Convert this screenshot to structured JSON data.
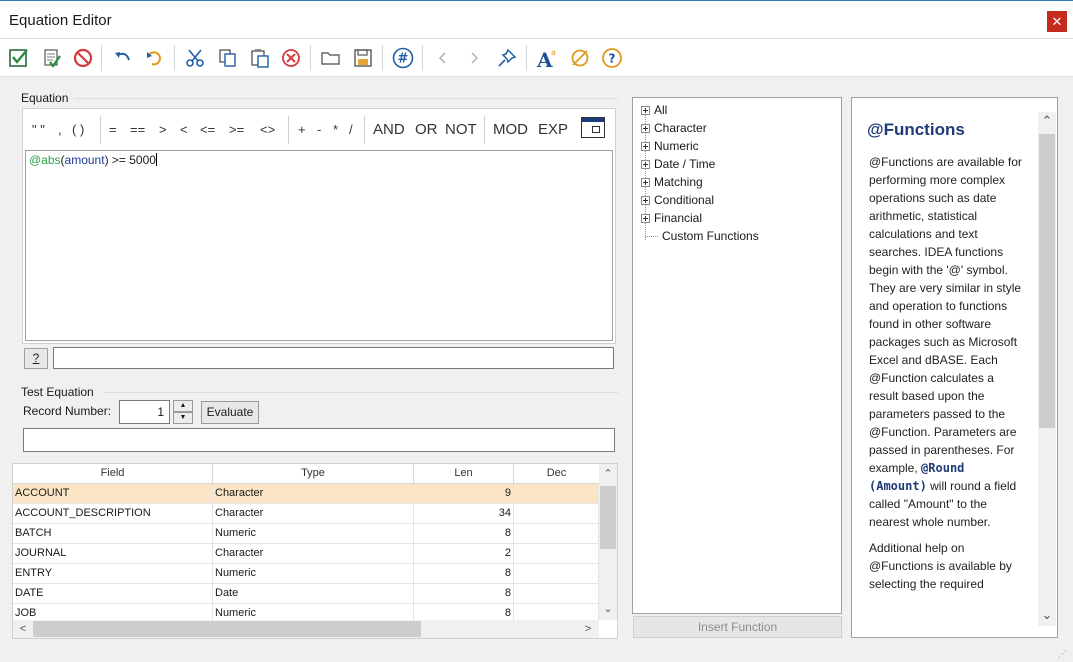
{
  "window": {
    "title": "Equation Editor",
    "close_glyph": "✕"
  },
  "toolbar": {
    "buttons": [
      {
        "name": "validate-exit-icon"
      },
      {
        "name": "validate-icon"
      },
      {
        "name": "cancel-icon"
      },
      {
        "name": "undo-icon"
      },
      {
        "name": "redo-icon"
      },
      {
        "name": "cut-icon"
      },
      {
        "name": "copy-icon"
      },
      {
        "name": "paste-icon"
      },
      {
        "name": "clear-icon"
      },
      {
        "name": "open-icon"
      },
      {
        "name": "save-icon"
      },
      {
        "name": "hash-icon"
      },
      {
        "name": "back-icon"
      },
      {
        "name": "forward-icon"
      },
      {
        "name": "pin-icon"
      },
      {
        "name": "font-icon"
      },
      {
        "name": "no-color-icon"
      },
      {
        "name": "help-icon"
      }
    ]
  },
  "equation": {
    "group_label": "Equation",
    "operators": {
      "quotes": "\" \"",
      "comma": ",",
      "parens": "( )",
      "eq": "=",
      "eqeq": "==",
      "gt": ">",
      "lt": "<",
      "le": "<=",
      "ge": ">=",
      "ne": "<>",
      "plus": "+",
      "minus": "-",
      "mult": "*",
      "div": "/",
      "and": "AND",
      "or": "OR",
      "not": "NOT",
      "mod": "MOD",
      "exp": "EXP"
    },
    "expression": {
      "function": "@abs",
      "open": "(",
      "field": "amount",
      "rest": ") >= 5000"
    },
    "help_button": "?",
    "status_text": ""
  },
  "test": {
    "group_label": "Test Equation",
    "record_label": "Record Number:",
    "record_value": "1",
    "evaluate_label": "Evaluate",
    "spin_up": "▲",
    "spin_down": "▼",
    "result_text": ""
  },
  "fields": {
    "headers": [
      "Field",
      "Type",
      "Len",
      "Dec"
    ],
    "rows": [
      {
        "field": "ACCOUNT",
        "type": "Character",
        "len": "9",
        "dec": ""
      },
      {
        "field": "ACCOUNT_DESCRIPTION",
        "type": "Character",
        "len": "34",
        "dec": ""
      },
      {
        "field": "BATCH",
        "type": "Numeric",
        "len": "8",
        "dec": ""
      },
      {
        "field": "JOURNAL",
        "type": "Character",
        "len": "2",
        "dec": ""
      },
      {
        "field": "ENTRY",
        "type": "Numeric",
        "len": "8",
        "dec": ""
      },
      {
        "field": "DATE",
        "type": "Date",
        "len": "8",
        "dec": ""
      },
      {
        "field": "JOB",
        "type": "Numeric",
        "len": "8",
        "dec": ""
      }
    ],
    "scroll_up": "⌃",
    "scroll_down": "⌄",
    "scroll_left": "<",
    "scroll_right": ">"
  },
  "tree": {
    "items": [
      "All",
      "Character",
      "Numeric",
      "Date / Time",
      "Matching",
      "Conditional",
      "Financial",
      "Custom Functions"
    ]
  },
  "insert_function_label": "Insert Function",
  "help": {
    "title": "@Functions",
    "p1a": "@Functions are available for performing more complex operations such as date arithmetic, statistical calculations and text searches. IDEA functions begin with the '@' symbol. They are very similar in style and operation to functions found in other software packages such as Microsoft Excel and dBASE. Each @Function calculates a result based upon the parameters passed to the @Function. Parameters are passed in parentheses. For example,",
    "p1_kw": "@Round (Amount)",
    "p1b": "will round a field called \"Amount\" to the nearest whole number.",
    "p2": "Additional help on @Functions is available by selecting the required",
    "scroll_up": "⌃",
    "scroll_down": "⌄"
  },
  "colors": {
    "selected_row": "#fbe5c4",
    "help_title": "#1f3b78",
    "function_green": "#2ca24a",
    "field_blue": "#1d3a9a"
  }
}
